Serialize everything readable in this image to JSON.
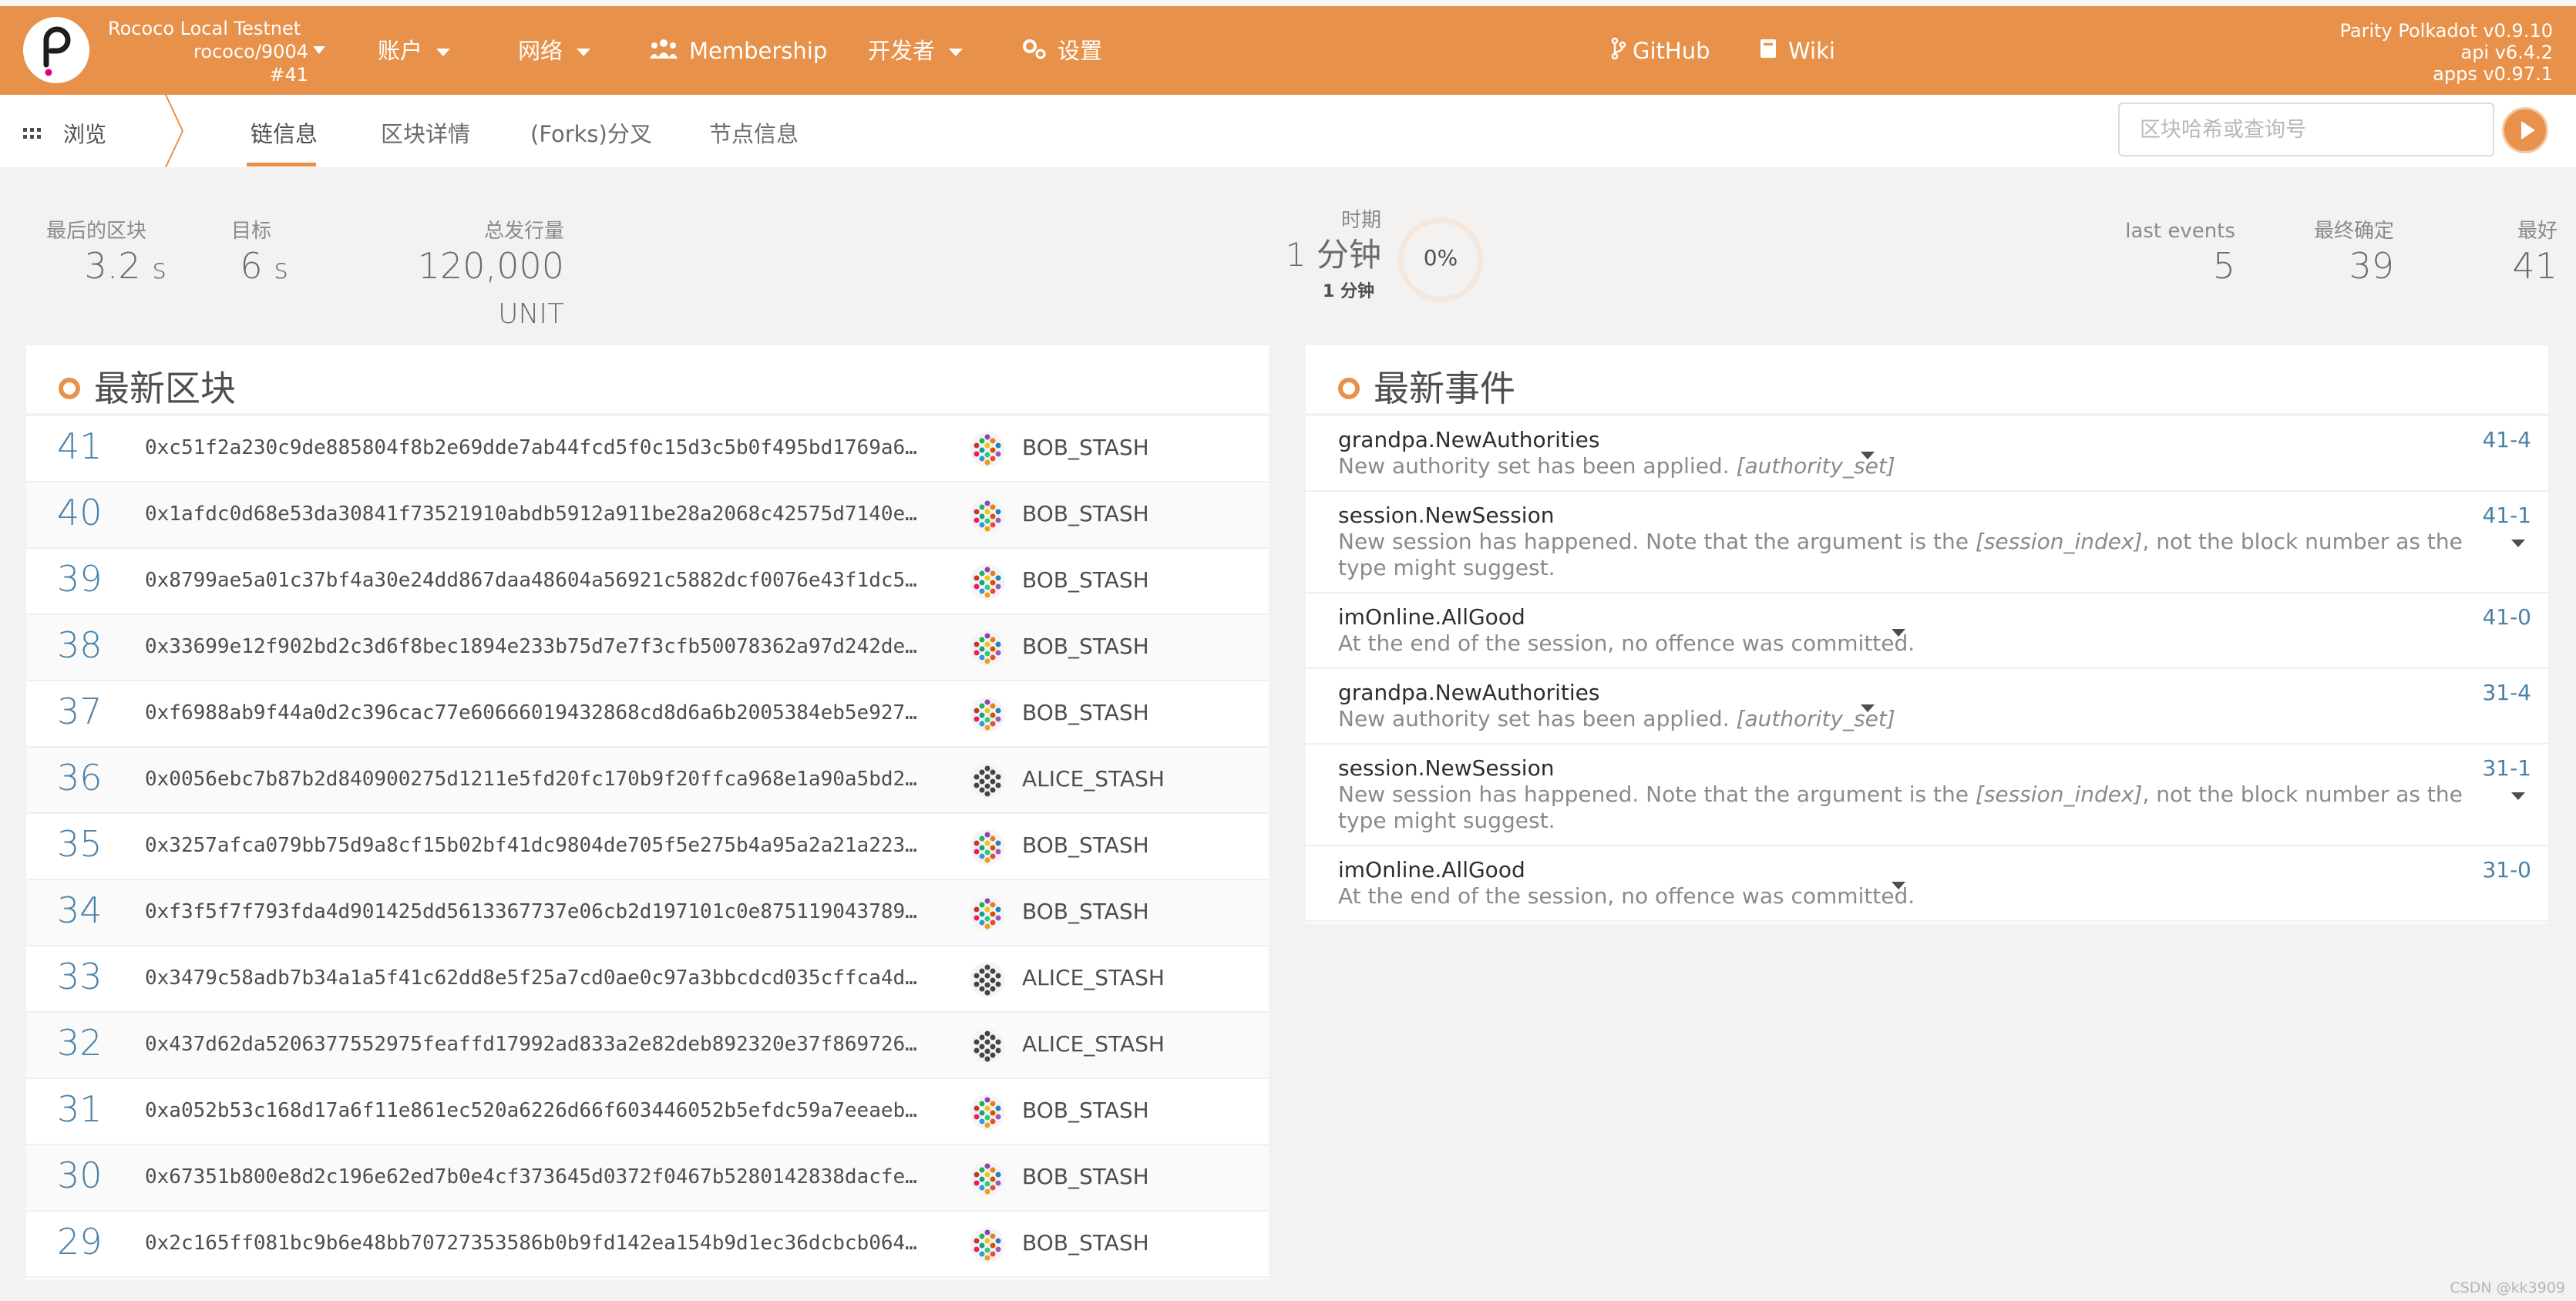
{
  "header": {
    "chain_name": "Rococo Local Testnet",
    "chain_endpoint": "rococo/9004",
    "chain_block": "#41",
    "nav": {
      "accounts": "账户",
      "network": "网络",
      "membership": "Membership",
      "developer": "开发者",
      "settings": "设置",
      "github": "GitHub",
      "wiki": "Wiki"
    },
    "version": [
      "Parity Polkadot v0.9.10",
      "api v6.4.2",
      "apps v0.97.1"
    ]
  },
  "subnav": {
    "browse": "浏览",
    "tabs": [
      "链信息",
      "区块详情",
      "(Forks)分叉",
      "节点信息"
    ],
    "search_placeholder": "区块哈希或查询号"
  },
  "summary": {
    "last_block": {
      "label": "最后的区块",
      "value": "3.2",
      "unit": "s"
    },
    "target": {
      "label": "目标",
      "value": "6",
      "unit": "s"
    },
    "total_issuance": {
      "label": "总发行量",
      "value": "120,000",
      "unit": "UNIT"
    },
    "epoch": {
      "label": "时期",
      "value": "1 分钟",
      "sub": "1 分钟",
      "percent": "0%",
      "progress": 0
    },
    "last_events": {
      "label": "last events",
      "value": "5"
    },
    "finalized": {
      "label": "最终确定",
      "value": "39"
    },
    "best": {
      "label": "最好",
      "value": "41"
    }
  },
  "blocks_panel": {
    "title": "最新区块",
    "rows": [
      {
        "number": "41",
        "hash": "0xc51f2a230c9de885804f8b2e69dde7ab44fcd5f0c15d3c5b0f495bd1769a6…",
        "author": "BOB_STASH"
      },
      {
        "number": "40",
        "hash": "0x1afdc0d68e53da30841f73521910abdb5912a911be28a2068c42575d7140e…",
        "author": "BOB_STASH"
      },
      {
        "number": "39",
        "hash": "0x8799ae5a01c37bf4a30e24dd867daa48604a56921c5882dcf0076e43f1dc5…",
        "author": "BOB_STASH"
      },
      {
        "number": "38",
        "hash": "0x33699e12f902bd2c3d6f8bec1894e233b75d7e7f3cfb50078362a97d242de…",
        "author": "BOB_STASH"
      },
      {
        "number": "37",
        "hash": "0xf6988ab9f44a0d2c396cac77e60666019432868cd8d6a6b2005384eb5e927…",
        "author": "BOB_STASH"
      },
      {
        "number": "36",
        "hash": "0x0056ebc7b87b2d840900275d1211e5fd20fc170b9f20ffca968e1a90a5bd2…",
        "author": "ALICE_STASH"
      },
      {
        "number": "35",
        "hash": "0x3257afca079bb75d9a8cf15b02bf41dc9804de705f5e275b4a95a2a21a223…",
        "author": "BOB_STASH"
      },
      {
        "number": "34",
        "hash": "0xf3f5f7f793fda4d901425dd5613367737e06cb2d197101c0e875119043789…",
        "author": "BOB_STASH"
      },
      {
        "number": "33",
        "hash": "0x3479c58adb7b34a1a5f41c62dd8e5f25a7cd0ae0c97a3bbcdcd035cffca4d…",
        "author": "ALICE_STASH"
      },
      {
        "number": "32",
        "hash": "0x437d62da5206377552975feaffd17992ad833a2e82deb892320e37f869726…",
        "author": "ALICE_STASH"
      },
      {
        "number": "31",
        "hash": "0xa052b53c168d17a6f11e861ec520a6226d66f603446052b5efdc59a7eeaeb…",
        "author": "BOB_STASH"
      },
      {
        "number": "30",
        "hash": "0x67351b800e8d2c196e62ed7b0e4cf373645d0372f0467b5280142838dacfe…",
        "author": "BOB_STASH"
      },
      {
        "number": "29",
        "hash": "0x2c165ff081bc9b6e48bb70727353586b0b9fd142ea154b9d1ec36dcbcb064…",
        "author": "BOB_STASH"
      }
    ]
  },
  "events_panel": {
    "title": "最新事件",
    "events": [
      {
        "name": "grandpa.NewAuthorities",
        "desc": "New authority set has been applied.",
        "desc_arg": "[authority_set]",
        "desc_tail": "",
        "id": "41-4"
      },
      {
        "name": "session.NewSession",
        "desc": "New session has happened. Note that the argument is the",
        "desc_arg": "[session_index]",
        "desc_tail": ", not the block number as the type might suggest.",
        "id": "41-1"
      },
      {
        "name": "imOnline.AllGood",
        "desc": "At the end of the session, no offence was committed.",
        "desc_arg": "",
        "desc_tail": "",
        "id": "41-0"
      },
      {
        "name": "grandpa.NewAuthorities",
        "desc": "New authority set has been applied.",
        "desc_arg": "[authority_set]",
        "desc_tail": "",
        "id": "31-4"
      },
      {
        "name": "session.NewSession",
        "desc": "New session has happened. Note that the argument is the",
        "desc_arg": "[session_index]",
        "desc_tail": ", not the block number as the type might suggest.",
        "id": "31-1"
      },
      {
        "name": "imOnline.AllGood",
        "desc": "At the end of the session, no offence was committed.",
        "desc_arg": "",
        "desc_tail": "",
        "id": "31-0"
      }
    ]
  },
  "watermark": "CSDN @kk3909",
  "colors": {
    "accent": "#e8914a",
    "link": "#4b82a8",
    "background": "#f3f2f1"
  },
  "icons": {
    "logo": "polkadot-logo-icon",
    "membership": "people-icon",
    "settings": "gear-icon",
    "github": "git-branch-icon",
    "wiki": "book-icon",
    "browse": "grid-icon",
    "search_go": "play-icon",
    "author": "identicon-icon"
  }
}
